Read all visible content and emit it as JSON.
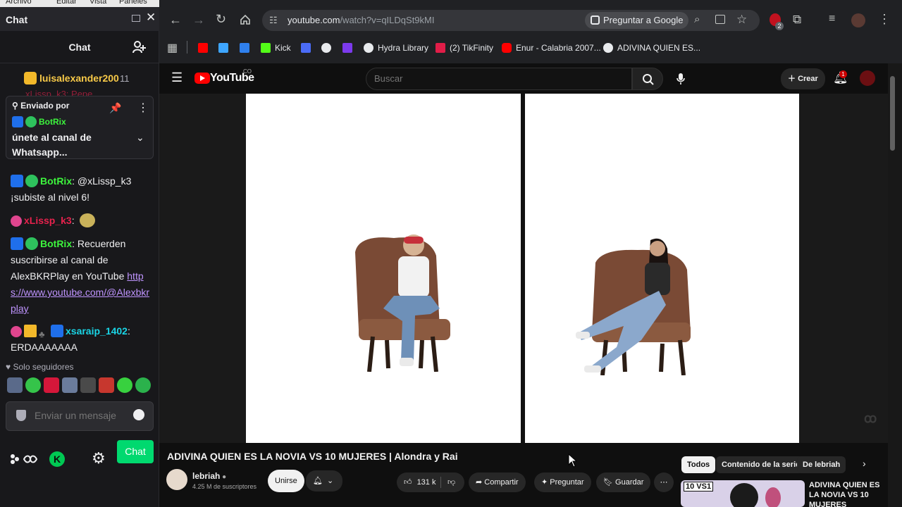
{
  "os_menu": [
    "Archivo",
    "Editar",
    "Vista",
    "Paneles"
  ],
  "chat": {
    "window_title": "Chat",
    "header_title": "Chat",
    "top_user": "luisalexander200",
    "top_count": "11",
    "faded_line": "xLissp_k3: Pepe",
    "pinned": {
      "label": "Enviado por",
      "user": "BotRix",
      "text": "únete al canal de Whatsapp..."
    },
    "messages": [
      {
        "user": "BotRix",
        "text": ": @xLissp_k3 ¡subiste al nivel 6!"
      },
      {
        "user": "xLissp_k3",
        "text": ":"
      },
      {
        "user": "BotRix",
        "text": ": Recuerden suscribirse al canal de AlexBKRPlay en YouTube",
        "link": "https://www.youtube.com/@Alexbkrplay"
      },
      {
        "user": "xsaraip_1402",
        "text": ": ERDAAAAAAA"
      }
    ],
    "followers_only": "Solo seguidores",
    "input_placeholder": "Enviar un mensaje",
    "chat_button": "Chat"
  },
  "browser": {
    "url_host": "youtube.com",
    "url_path": "/watch?v=qILDqSt9kMI",
    "google_button": "Preguntar a Google",
    "extension_badge": "2",
    "bookmarks": [
      {
        "label": "",
        "color": "#ff0000"
      },
      {
        "label": "",
        "color": "#3ea6ff"
      },
      {
        "label": "",
        "color": "#2f80ed"
      },
      {
        "label": "Kick",
        "color": "#53fc18"
      },
      {
        "label": "",
        "color": "#4b6cf7"
      },
      {
        "label": "",
        "color": "#e8eaed"
      },
      {
        "label": "",
        "color": "#7c3aed"
      },
      {
        "label": "Hydra Library",
        "color": "#e8eaed"
      },
      {
        "label": "(2) TikFinity",
        "color": "#e11d48"
      },
      {
        "label": "Enur - Calabria 2007...",
        "color": "#ff0000"
      },
      {
        "label": "ADIVINA QUIEN ES...",
        "color": "#e8eaed"
      }
    ]
  },
  "youtube": {
    "logo_text": "YouTube",
    "logo_country": "CO",
    "search_placeholder": "Buscar",
    "create_label": "Crear",
    "notif_count": "1",
    "video_title": "ADIVINA QUIEN ES LA NOVIA VS 10 MUJERES | Alondra y Rai",
    "channel_name": "lebriah",
    "subscribers": "4.25 M de suscriptores",
    "join_label": "Unirse",
    "likes": "131 k",
    "share_label": "Compartir",
    "ask_label": "Preguntar",
    "save_label": "Guardar",
    "chips": [
      "Todos",
      "Contenido de la serie",
      "De lebriah"
    ],
    "rec_title": "ADIVINA QUIEN ES LA NOVIA VS 10 MUJERES",
    "rec_thumb_text": "10 VS1"
  }
}
